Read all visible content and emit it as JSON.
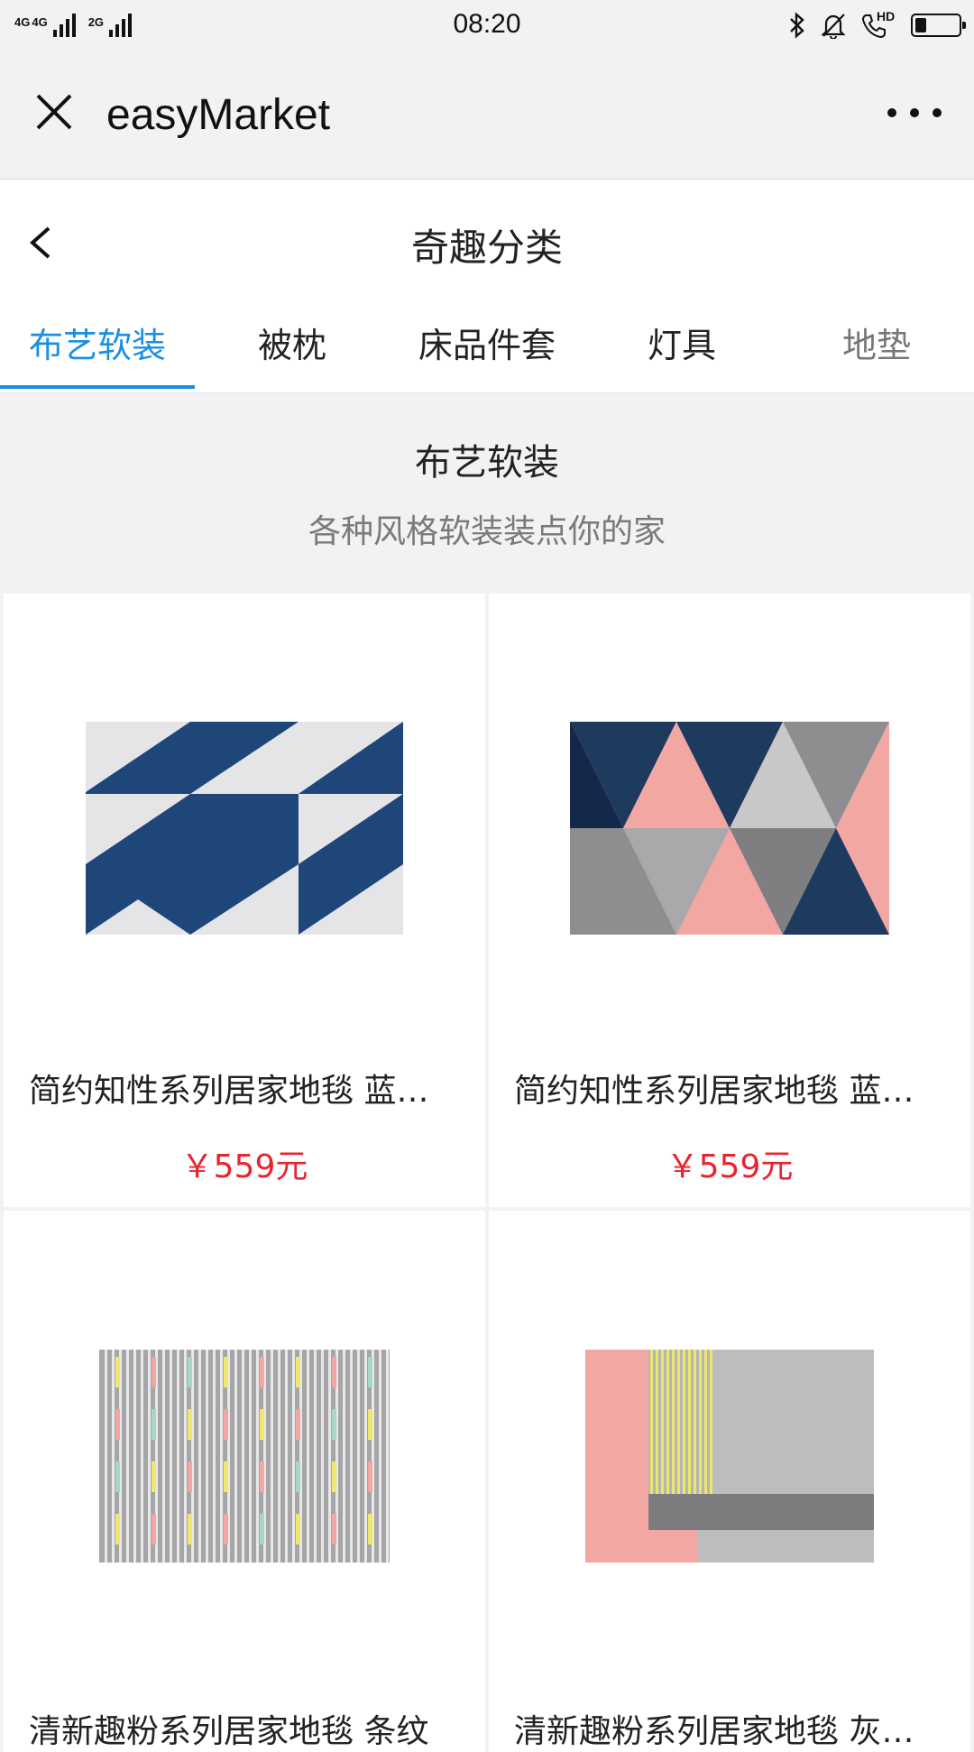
{
  "status_bar": {
    "sim1_label": "4G",
    "sim1b_label": "4G",
    "sim2_label": "2G",
    "time": "08:20",
    "hd_label": "HD",
    "battery_level": 0.25
  },
  "app_bar": {
    "title": "easyMarket",
    "close_icon": "close-icon",
    "more_icon": "more-dots-icon"
  },
  "page": {
    "title": "奇趣分类",
    "back_icon": "chevron-left-icon"
  },
  "tabs": [
    {
      "label": "布艺软装",
      "active": true
    },
    {
      "label": "被枕",
      "active": false
    },
    {
      "label": "床品件套",
      "active": false
    },
    {
      "label": "灯具",
      "active": false
    },
    {
      "label": "地垫",
      "active": false
    }
  ],
  "category": {
    "title": "布艺软装",
    "subtitle": "各种风格软装装点你的家"
  },
  "products": [
    {
      "name": "简约知性系列居家地毯 蓝白色",
      "price": "￥559元",
      "image": "rug-blue-white-diagonal"
    },
    {
      "name": "简约知性系列居家地毯 蓝粉色",
      "price": "￥559元",
      "image": "rug-triangles-pink-navy-grey"
    },
    {
      "name": "清新趣粉系列居家地毯 条纹",
      "price": "",
      "image": "rug-grey-stripes"
    },
    {
      "name": "清新趣粉系列居家地毯 灰粉色",
      "price": "",
      "image": "rug-pink-grey-yellow-stripes"
    }
  ],
  "colors": {
    "accent": "#1a8fe3",
    "price": "#e8242c",
    "navy": "#1e4679",
    "pink": "#f2a7a3",
    "grey": "#a9a9ab"
  }
}
